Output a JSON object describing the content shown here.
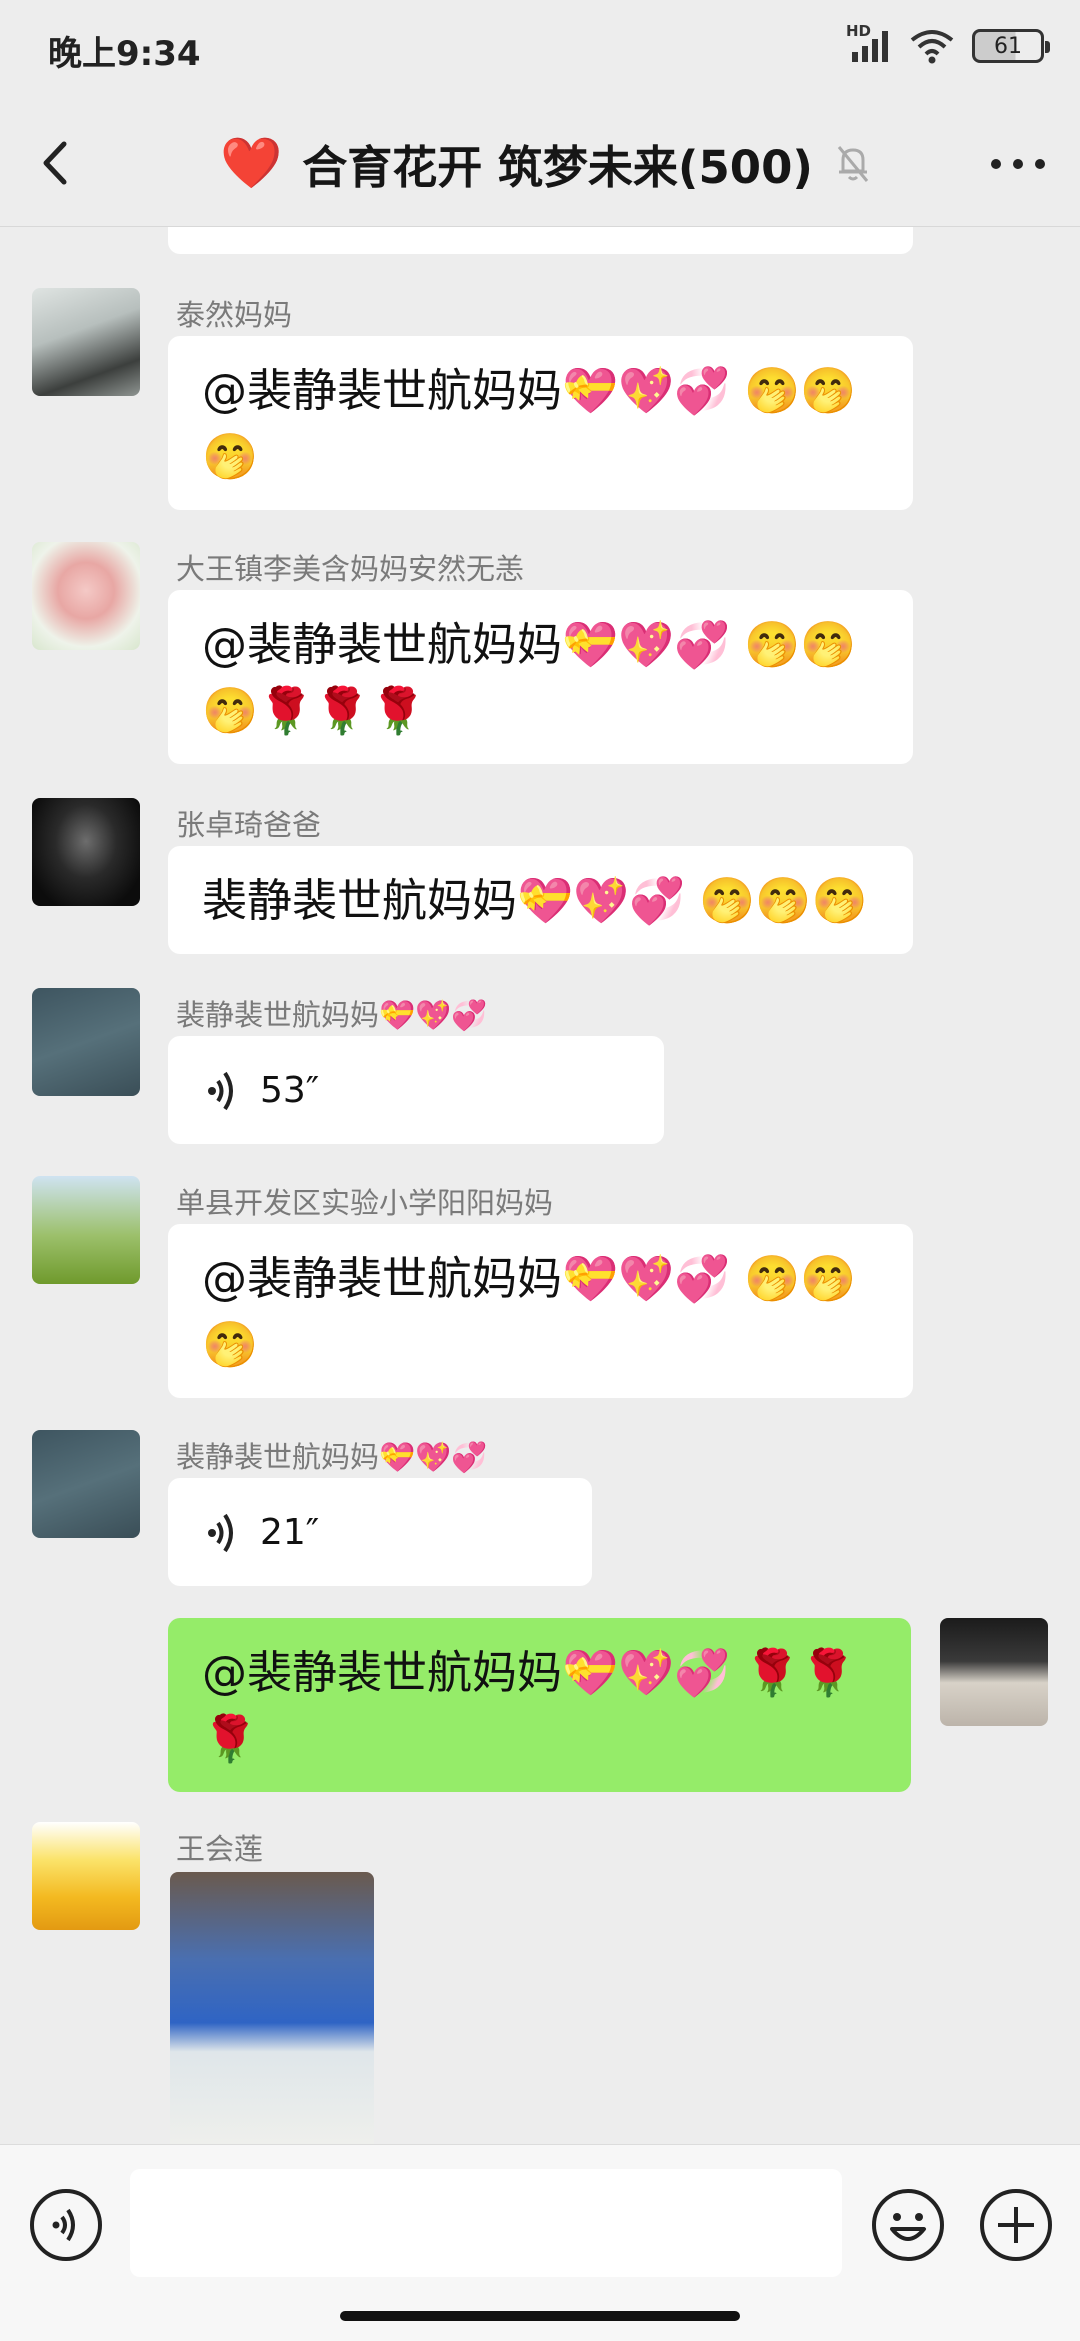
{
  "status_bar": {
    "time": "晚上9:34",
    "battery": "61",
    "network_label": "HD"
  },
  "header": {
    "heart": "❤️",
    "title": "合育花开 筑梦未来(500)"
  },
  "messages": [
    {
      "sender": "泰然妈妈",
      "text": "@裴静裴世航妈妈💝💖💞 🤭🤭🤭"
    },
    {
      "sender": "大王镇李美含妈妈安然无恙",
      "text": "@裴静裴世航妈妈💝💖💞 🤭🤭🤭🌹🌹🌹"
    },
    {
      "sender": "张卓琦爸爸",
      "text": "裴静裴世航妈妈💝💖💞 🤭🤭🤭"
    },
    {
      "sender": "裴静裴世航妈妈💝💖💞",
      "voice_duration": "53″"
    },
    {
      "sender": "单县开发区实验小学阳阳妈妈",
      "text": "@裴静裴世航妈妈💝💖💞 🤭🤭🤭"
    },
    {
      "sender": "裴静裴世航妈妈💝💖💞",
      "voice_duration": "21″"
    },
    {
      "sender": "",
      "text": "@裴静裴世航妈妈💝💖💞 🌹🌹🌹"
    },
    {
      "sender": "王会莲"
    }
  ],
  "colors": {
    "background": "#ededed",
    "incoming_bubble": "#ffffff",
    "outgoing_bubble": "#95ec69"
  },
  "icons": [
    "back-icon",
    "mute-bell-icon",
    "more-icon",
    "voice-input-icon",
    "emoji-icon",
    "plus-icon",
    "voice-wave-icon"
  ]
}
